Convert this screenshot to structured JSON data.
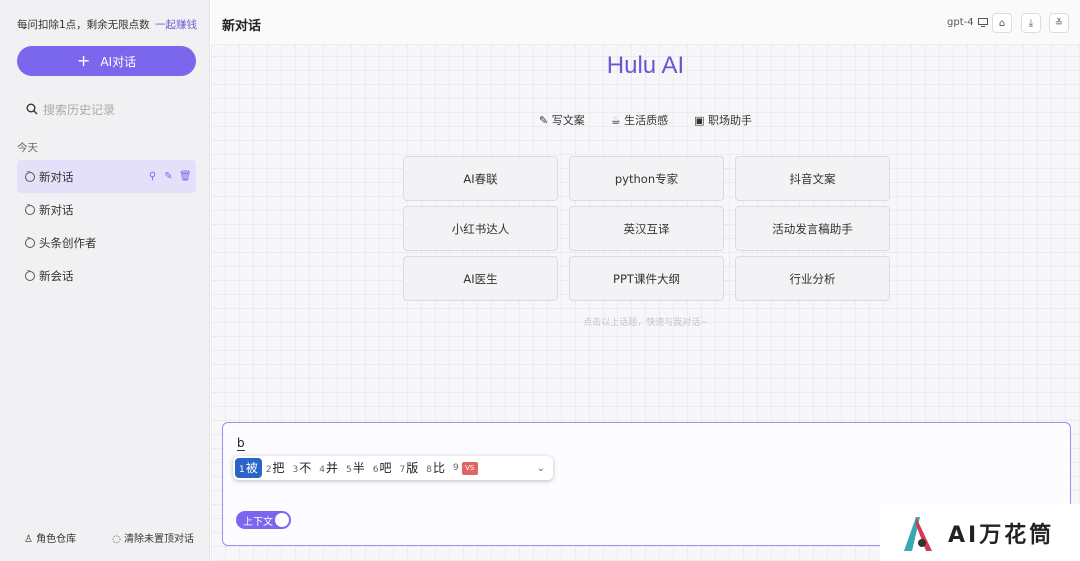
{
  "sidebar": {
    "quota_text": "每问扣除1点，剩余无限点数",
    "earn_link": "一起赚钱",
    "new_chat_label": "AI对话",
    "search_placeholder": "搜索历史记录",
    "group_label": "今天",
    "conversations": [
      {
        "label": "新对话",
        "active": true
      },
      {
        "label": "新对话",
        "active": false
      },
      {
        "label": "头条创作者",
        "active": false
      },
      {
        "label": "新会话",
        "active": false
      }
    ],
    "role_store": "角色仓库",
    "clear_unpinned": "清除未置顶对话"
  },
  "header": {
    "title": "新对话",
    "model": "gpt-4"
  },
  "main": {
    "brand": "Hulu AI",
    "quick_tabs": [
      {
        "label": "写文案",
        "icon": "pencil-icon"
      },
      {
        "label": "生活质感",
        "icon": "cup-icon"
      },
      {
        "label": "职场助手",
        "icon": "briefcase-icon"
      }
    ],
    "cards": [
      "AI春联",
      "python专家",
      "抖音文案",
      "小红书达人",
      "英汉互译",
      "活动发言稿助手",
      "AI医生",
      "PPT课件大纲",
      "行业分析"
    ],
    "hint": "点击以上话题，快速与我对话~"
  },
  "input": {
    "value": "b",
    "ime_candidates": [
      {
        "num": "1",
        "text": "被"
      },
      {
        "num": "2",
        "text": "把"
      },
      {
        "num": "3",
        "text": "不"
      },
      {
        "num": "4",
        "text": "并"
      },
      {
        "num": "5",
        "text": "半"
      },
      {
        "num": "6",
        "text": "吧"
      },
      {
        "num": "7",
        "text": "版"
      },
      {
        "num": "8",
        "text": "比"
      },
      {
        "num": "9",
        "text": ""
      }
    ],
    "vs_badge": "VS",
    "context_toggle": "上下文"
  },
  "watermark": {
    "text": "AI万花筒"
  },
  "colors": {
    "accent": "#7b67ee",
    "brand_text": "#6b55d6",
    "ime_selected": "#2a64c8"
  }
}
